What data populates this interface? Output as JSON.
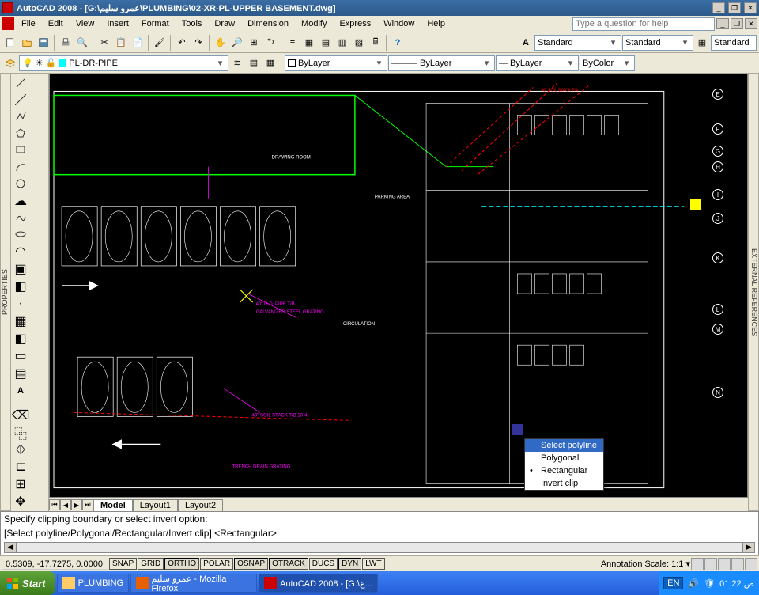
{
  "titlebar": {
    "text": "AutoCAD 2008 - [G:\\عمرو سليم\\PLUMBING\\02-XR-PL-UPPER BASEMENT.dwg]"
  },
  "menu": {
    "items": [
      "File",
      "Edit",
      "View",
      "Insert",
      "Format",
      "Tools",
      "Draw",
      "Dimension",
      "Modify",
      "Express",
      "Window",
      "Help"
    ],
    "help_placeholder": "Type a question for help"
  },
  "std": {
    "s1": "Standard",
    "s2": "Standard",
    "s3": "Standard"
  },
  "layer": {
    "current": "PL-DR-PIPE",
    "props_color": "ByLayer",
    "props_ltype": "ByLayer",
    "props_lweight": "ByLayer",
    "props_pstyle": "ByColor"
  },
  "tabs": {
    "model": "Model",
    "layout1": "Layout1",
    "layout2": "Layout2"
  },
  "cmd": {
    "line1": "Specify clipping boundary or select invert option:",
    "line2": "[Select polyline/Polygonal/Rectangular/Invert clip] <Rectangular>:"
  },
  "context_menu": {
    "items": [
      "Select polyline",
      "Polygonal",
      "Rectangular",
      "Invert clip"
    ],
    "selected": 0,
    "default_marked": 2
  },
  "status": {
    "coords": "0.5309, -17.7275, 0.0000",
    "btns": [
      "SNAP",
      "GRID",
      "ORTHO",
      "POLAR",
      "OSNAP",
      "OTRACK",
      "DUCS",
      "DYN",
      "LWT"
    ],
    "anno": "Annotation Scale: 1:1 ▾"
  },
  "taskbar": {
    "start": "Start",
    "items": [
      {
        "label": "PLUMBING",
        "active": false
      },
      {
        "label": "عمرو سليم - Mozilla Firefox",
        "active": false
      },
      {
        "label": "AutoCAD 2008 - [G:\\ع...",
        "active": true
      }
    ],
    "lang": "EN",
    "time": "01:22 ص"
  },
  "drawing": {
    "labels": {
      "a": "TRENCH DRAIN GRATING",
      "b": "40\" SOIL STACK T/B 10-4",
      "c": "40\" G.D. PIPE T/B",
      "d": "GALVANIZED STEEL GRATING",
      "e": "DRAWING ROOM",
      "f": "PARKING AREA",
      "g": "46\" SOIL STACK F/A",
      "h": "CIRCULATION"
    },
    "grid_refs": [
      "E",
      "F",
      "G",
      "H",
      "I",
      "J",
      "K",
      "L",
      "M",
      "N"
    ]
  },
  "vert_tabs": {
    "left": "PROPERTIES",
    "right": "EXTERNAL REFERENCES"
  }
}
